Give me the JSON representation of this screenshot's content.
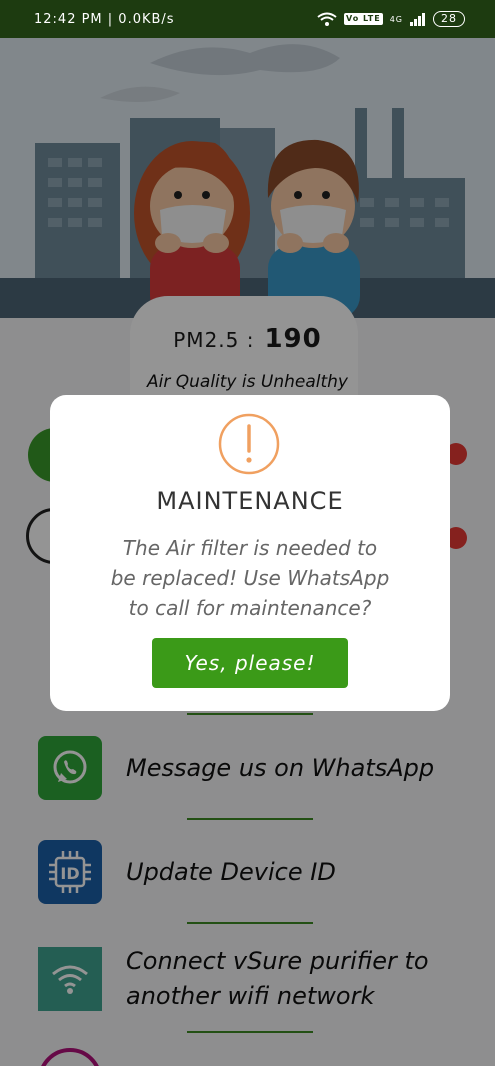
{
  "status_bar": {
    "time": "12:42 PM | 0.0KB/s",
    "volte": "Vo LTE",
    "network": "4G",
    "battery": "28"
  },
  "air": {
    "pm_label": "PM2.5 :",
    "pm_value": "190",
    "quality_text": "Air Quality is Unhealthy"
  },
  "menu": {
    "whatsapp_label": "Message us on WhatsApp",
    "device_id_label": "Update Device ID",
    "wifi_label_line1": "Connect vSure purifier to",
    "wifi_label_line2": "another wifi network"
  },
  "dialog": {
    "icon": "exclamation-icon",
    "title": "MAINTENANCE",
    "message_line1": "The Air filter is needed to",
    "message_line2": "be replaced! Use WhatsApp",
    "message_line3": "to call for maintenance?",
    "confirm_label": "Yes, please!"
  },
  "colors": {
    "status_bar": "#1d3b10",
    "accent_green": "#3b9a18",
    "divider_green": "#3d8a24",
    "warning_orange": "#f0a060",
    "alert_red": "#e53935",
    "whatsapp_green": "#2fa53a",
    "device_id_blue": "#1a5fa8",
    "wifi_teal": "#3fa38f"
  }
}
